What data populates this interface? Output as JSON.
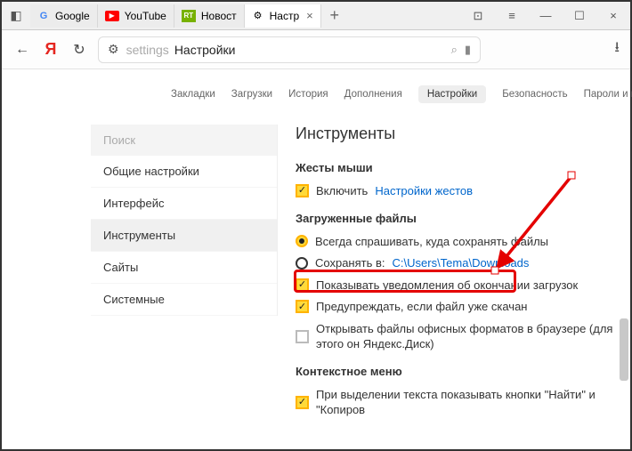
{
  "titlebar": {
    "tabs": [
      {
        "label": "Google",
        "favicon": "G",
        "color": "#4285F4"
      },
      {
        "label": "YouTube",
        "favicon": "▶",
        "color": "#ff0000"
      },
      {
        "label": "Новост",
        "favicon": "RT",
        "color": "#77b100"
      },
      {
        "label": "Настр",
        "favicon": "⚙",
        "color": "#555",
        "active": true
      }
    ]
  },
  "addressbar": {
    "path_dim": "settings",
    "path_main": "Настройки"
  },
  "topnav": {
    "items": [
      "Закладки",
      "Загрузки",
      "История",
      "Дополнения",
      "Настройки",
      "Безопасность",
      "Пароли и карты"
    ],
    "selected": "Настройки"
  },
  "sidebar": {
    "search_placeholder": "Поиск",
    "items": [
      "Общие настройки",
      "Интерфейс",
      "Инструменты",
      "Сайты",
      "Системные"
    ],
    "active": "Инструменты"
  },
  "main": {
    "heading": "Инструменты",
    "mouse_section": "Жесты мыши",
    "mouse_enable": "Включить",
    "mouse_link": "Настройки жестов",
    "dl_section": "Загруженные файлы",
    "dl_radio_ask": "Всегда спрашивать, куда сохранять файлы",
    "dl_radio_save": "Сохранять в:",
    "dl_path": "C:\\Users\\Tema\\Downloads",
    "dl_notify": "Показывать уведомления об окончании загрузок",
    "dl_warn": "Предупреждать, если файл уже скачан",
    "dl_office": "Открывать файлы офисных форматов в браузере (для этого он Яндекс.Диск)",
    "ctx_section": "Контекстное меню",
    "ctx_find_copy": "При выделении текста показывать кнопки \"Найти\" и \"Копиров"
  }
}
